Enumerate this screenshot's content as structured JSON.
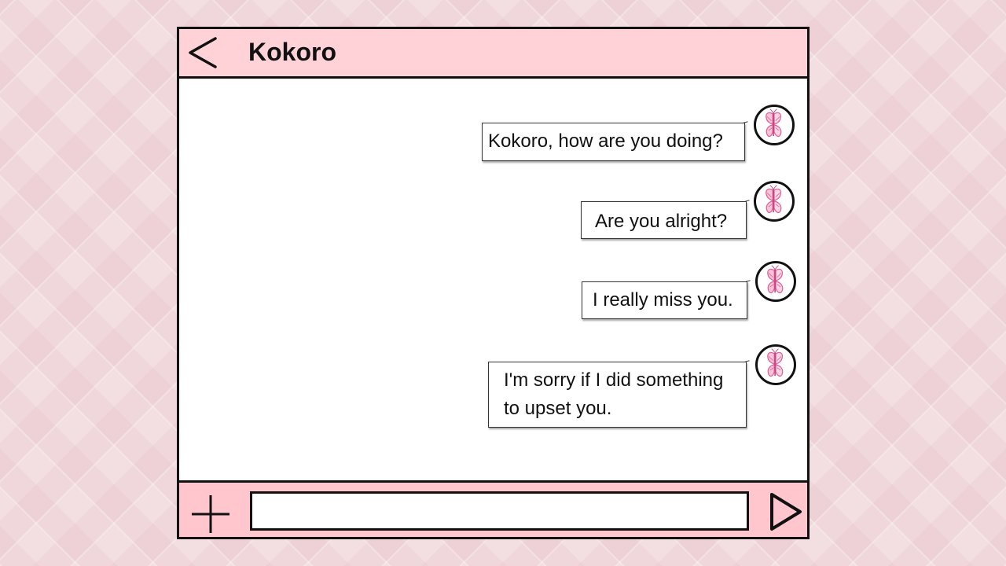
{
  "header": {
    "back_icon": "chevron-left-icon",
    "title": "Kokoro"
  },
  "messages": [
    {
      "text": "Kokoro, how are you doing?",
      "avatar_icon": "butterfly-icon"
    },
    {
      "text": "Are you alright?",
      "avatar_icon": "butterfly-icon"
    },
    {
      "text": "I really miss you.",
      "avatar_icon": "butterfly-icon"
    },
    {
      "text": "I'm sorry if I did something to upset you.",
      "avatar_icon": "butterfly-icon"
    }
  ],
  "composer": {
    "add_icon": "plus-icon",
    "input_value": "",
    "input_placeholder": "",
    "send_icon": "send-icon"
  },
  "colors": {
    "header_bg": "#ffd2d8",
    "footer_bg": "#ffc6cd",
    "border": "#111111",
    "butterfly": "#e0609a"
  }
}
